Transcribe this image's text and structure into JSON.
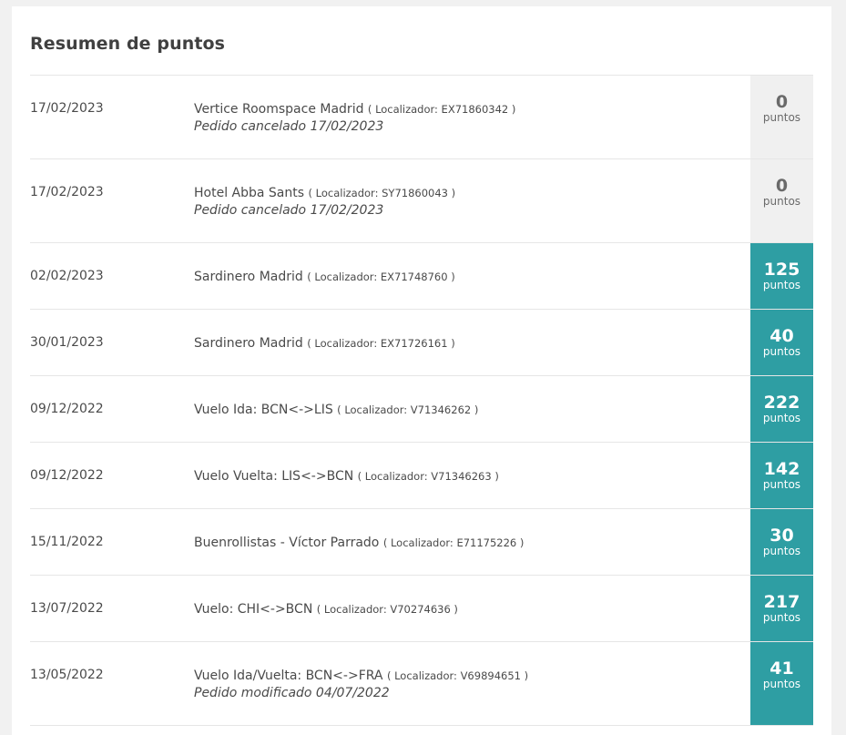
{
  "section": {
    "title": "Resumen de puntos",
    "unit_label": "puntos",
    "loc_prefix": "( Localizador: ",
    "loc_suffix": " )"
  },
  "rows": [
    {
      "date": "17/02/2023",
      "name": "Vertice Roomspace Madrid",
      "locator": "EX71860342",
      "note": "Pedido cancelado 17/02/2023",
      "points": "0"
    },
    {
      "date": "17/02/2023",
      "name": "Hotel Abba Sants",
      "locator": "SY71860043",
      "note": "Pedido cancelado 17/02/2023",
      "points": "0"
    },
    {
      "date": "02/02/2023",
      "name": "Sardinero Madrid",
      "locator": "EX71748760",
      "note": "",
      "points": "125"
    },
    {
      "date": "30/01/2023",
      "name": "Sardinero Madrid",
      "locator": "EX71726161",
      "note": "",
      "points": "40"
    },
    {
      "date": "09/12/2022",
      "name": "Vuelo Ida: BCN<->LIS",
      "locator": "V71346262",
      "note": "",
      "points": "222"
    },
    {
      "date": "09/12/2022",
      "name": "Vuelo Vuelta: LIS<->BCN",
      "locator": "V71346263",
      "note": "",
      "points": "142"
    },
    {
      "date": "15/11/2022",
      "name": "Buenrollistas - Víctor Parrado",
      "locator": "E71175226",
      "note": "",
      "points": "30"
    },
    {
      "date": "13/07/2022",
      "name": "Vuelo: CHI<->BCN",
      "locator": "V70274636",
      "note": "",
      "points": "217"
    },
    {
      "date": "13/05/2022",
      "name": "Vuelo Ida/Vuelta: BCN<->FRA",
      "locator": "V69894651",
      "note": "Pedido modificado 04/07/2022",
      "points": "41"
    }
  ]
}
